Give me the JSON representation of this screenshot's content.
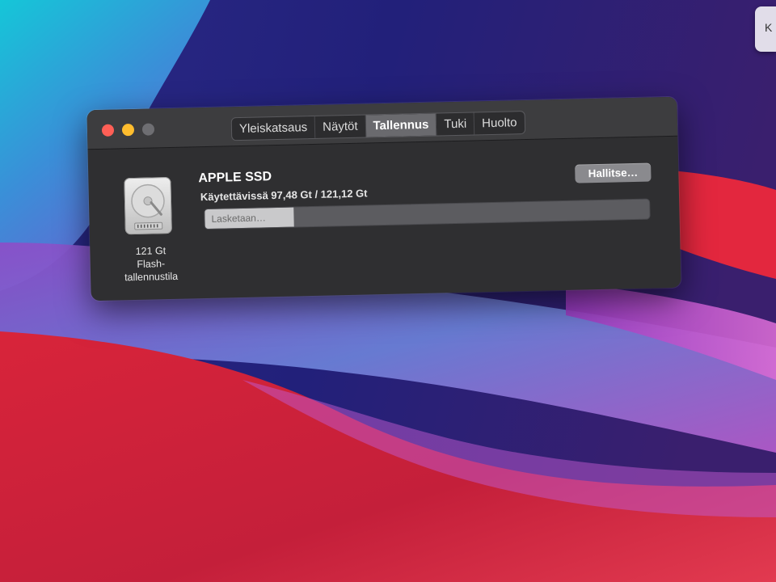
{
  "colors": {
    "window_bg": "#2f2f31",
    "titlebar_bg": "#3d3d3f",
    "close": "#ff5f56",
    "minimize": "#ffbd2e",
    "zoom": "#6e6e72",
    "bar_track": "#5c5c60",
    "bar_fill": "#c9c9cb"
  },
  "desktop": {
    "corner_widget_text": "K"
  },
  "window": {
    "tabs": [
      {
        "label": "Yleiskatsaus",
        "active": false
      },
      {
        "label": "Näytöt",
        "active": false
      },
      {
        "label": "Tallennus",
        "active": true
      },
      {
        "label": "Tuki",
        "active": false
      },
      {
        "label": "Huolto",
        "active": false
      }
    ],
    "disk": {
      "icon": "hard-drive-icon",
      "capacity": "121 Gt",
      "type_line1": "Flash-",
      "type_line2": "tallennustila",
      "name": "APPLE SSD",
      "available": "Käytettävissä 97,48 Gt / 121,12 Gt",
      "manage_label": "Hallitse…",
      "bar_label": "Lasketaan…",
      "bar_fraction": 0.2
    }
  }
}
